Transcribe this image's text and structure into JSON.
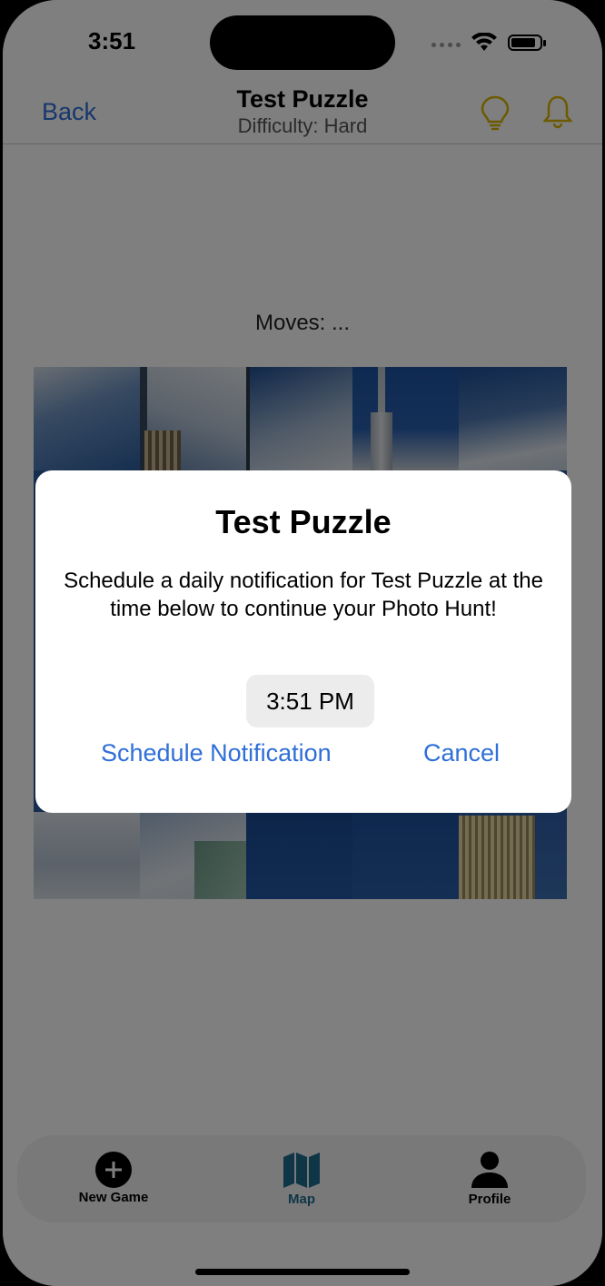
{
  "status_bar": {
    "time": "3:51"
  },
  "nav": {
    "back_label": "Back",
    "title": "Test Puzzle",
    "subtitle": "Difficulty: Hard",
    "icon_color": "#d8b400"
  },
  "game": {
    "moves_label": "Moves: ..."
  },
  "tabs": [
    {
      "label": "New Game",
      "icon": "plus-circle-icon"
    },
    {
      "label": "Map",
      "icon": "map-icon",
      "selected": true,
      "color": "#1f6d8f"
    },
    {
      "label": "Profile",
      "icon": "person-icon"
    }
  ],
  "dialog": {
    "title": "Test Puzzle",
    "message": "Schedule a daily notification for Test Puzzle at the time below to continue your Photo Hunt!",
    "time": "3:51 PM",
    "schedule_label": "Schedule Notification",
    "cancel_label": "Cancel"
  },
  "colors": {
    "accent": "#2f6fd8",
    "overlay": "rgba(0,0,0,0.5)"
  }
}
